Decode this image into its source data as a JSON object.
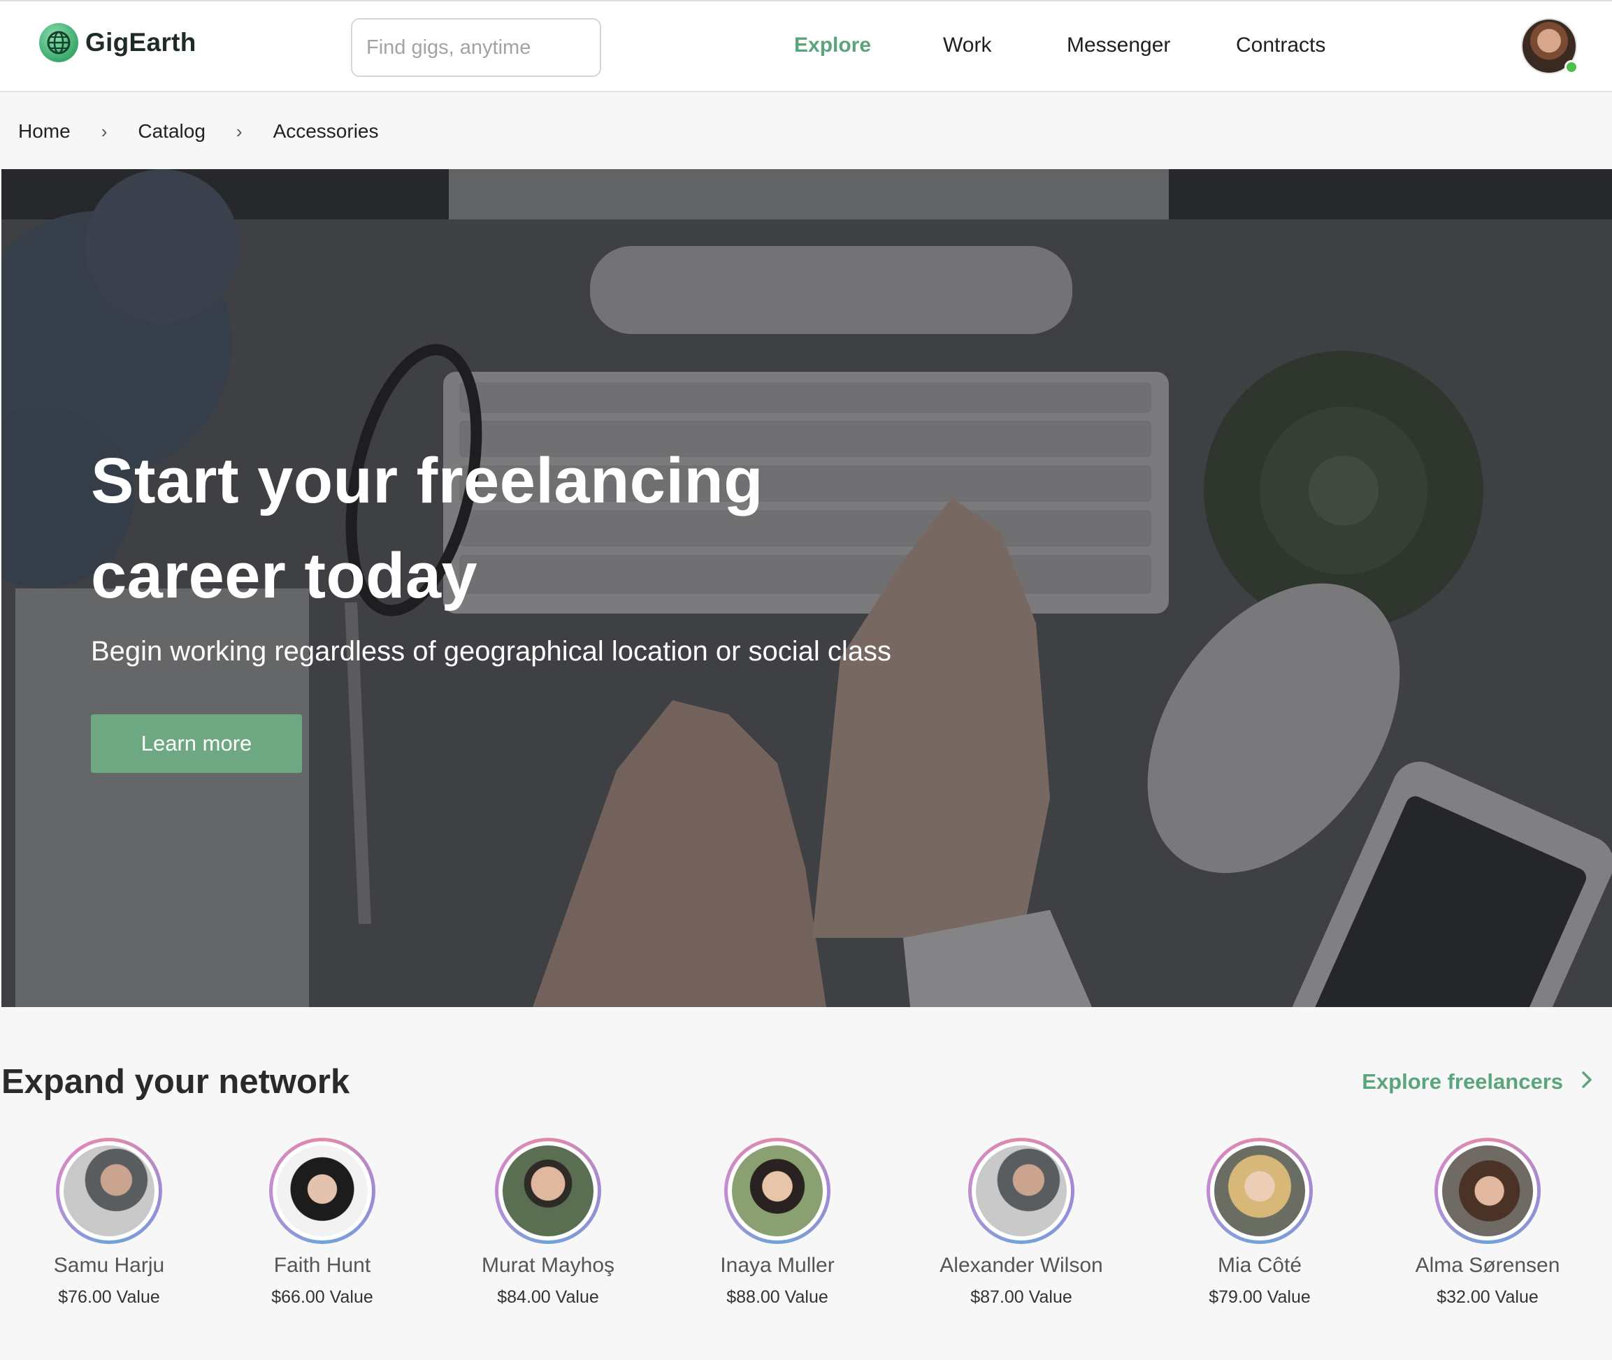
{
  "brand": {
    "name": "GigEarth",
    "accent": "#5ca57c"
  },
  "search": {
    "placeholder": "Find gigs, anytime",
    "value": ""
  },
  "nav": {
    "items": [
      {
        "label": "Explore",
        "active": true
      },
      {
        "label": "Work",
        "active": false
      },
      {
        "label": "Messenger",
        "active": false
      },
      {
        "label": "Contracts",
        "active": false
      }
    ]
  },
  "user": {
    "status": "online",
    "status_color": "#4ec04e"
  },
  "breadcrumb": [
    "Home",
    "Catalog",
    "Accessories"
  ],
  "hero": {
    "title": "Start your freelancing career today",
    "subtitle": "Begin working regardless of geographical location or social class",
    "button_label": "Learn more"
  },
  "network": {
    "title": "Expand your network",
    "explore_label": "Explore freelancers",
    "people": [
      {
        "name": "Samu Harju",
        "value": "$76.00 Value"
      },
      {
        "name": "Faith Hunt",
        "value": "$66.00 Value"
      },
      {
        "name": "Murat Mayhoş",
        "value": "$84.00 Value"
      },
      {
        "name": "Inaya Muller",
        "value": "$88.00 Value"
      },
      {
        "name": "Alexander Wilson",
        "value": "$87.00 Value"
      },
      {
        "name": "Mia Côté",
        "value": "$79.00 Value"
      },
      {
        "name": "Alma Sørensen",
        "value": "$32.00 Value"
      }
    ]
  }
}
